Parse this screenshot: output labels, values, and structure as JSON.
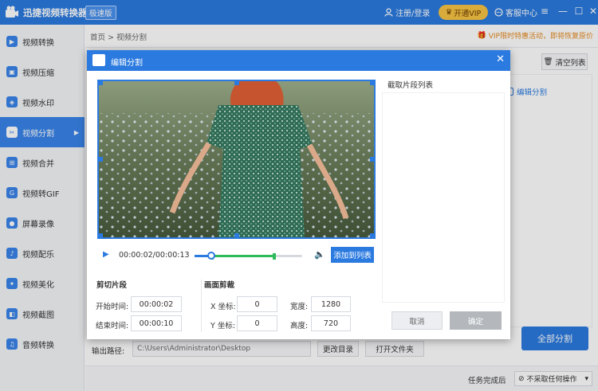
{
  "app": {
    "title": "迅捷视频转换器",
    "edition": "极速版"
  },
  "header": {
    "login": "注册/登录",
    "vip": "开通VIP",
    "service": "客服中心"
  },
  "sidebar": {
    "items": [
      {
        "label": "视频转换",
        "icon": "convert-icon"
      },
      {
        "label": "视频压缩",
        "icon": "compress-icon"
      },
      {
        "label": "视频水印",
        "icon": "watermark-icon"
      },
      {
        "label": "视频分割",
        "icon": "split-icon",
        "active": true
      },
      {
        "label": "视频合并",
        "icon": "merge-icon"
      },
      {
        "label": "视频转GIF",
        "icon": "gif-icon"
      },
      {
        "label": "屏幕录像",
        "icon": "record-icon"
      },
      {
        "label": "视频配乐",
        "icon": "music-icon"
      },
      {
        "label": "视频美化",
        "icon": "beautify-icon"
      },
      {
        "label": "视频截图",
        "icon": "screenshot-icon"
      },
      {
        "label": "音频转换",
        "icon": "audio-icon"
      }
    ]
  },
  "main": {
    "breadcrumb_home": "首页",
    "breadcrumb_sep": ">",
    "breadcrumb_current": "视频分割",
    "promo": "VIP限时特惠活动，即将恢复原价",
    "clear_list": "清空列表",
    "edit_split": "编辑分割",
    "output_label": "输出路径:",
    "output_path": "C:\\Users\\Administrator\\Desktop",
    "change_dir": "更改目录",
    "open_folder": "打开文件夹",
    "split_all": "全部分割",
    "after_complete_label": "任务完成后",
    "after_complete_value": "不采取任何操作"
  },
  "dialog": {
    "title": "编辑分割",
    "timecode": "00:00:02/00:00:13",
    "add_to_list": "添加到列表",
    "cut_section": {
      "title": "剪切片段",
      "start_label": "开始时间:",
      "start_value": "00:00:02",
      "end_label": "结束时间:",
      "end_value": "00:00:10"
    },
    "crop_section": {
      "title": "画面剪裁",
      "x_label": "X 坐标:",
      "x_value": "0",
      "y_label": "Y 坐标:",
      "y_value": "0",
      "width_label": "宽度:",
      "width_value": "1280",
      "height_label": "高度:",
      "height_value": "720"
    },
    "clip_list_title": "截取片段列表",
    "cancel": "取消",
    "confirm": "确定"
  },
  "colors": {
    "accent": "#2b7ae0",
    "range": "#2dbb5b",
    "vip": "#f6c344",
    "promo": "#e58a1f"
  }
}
